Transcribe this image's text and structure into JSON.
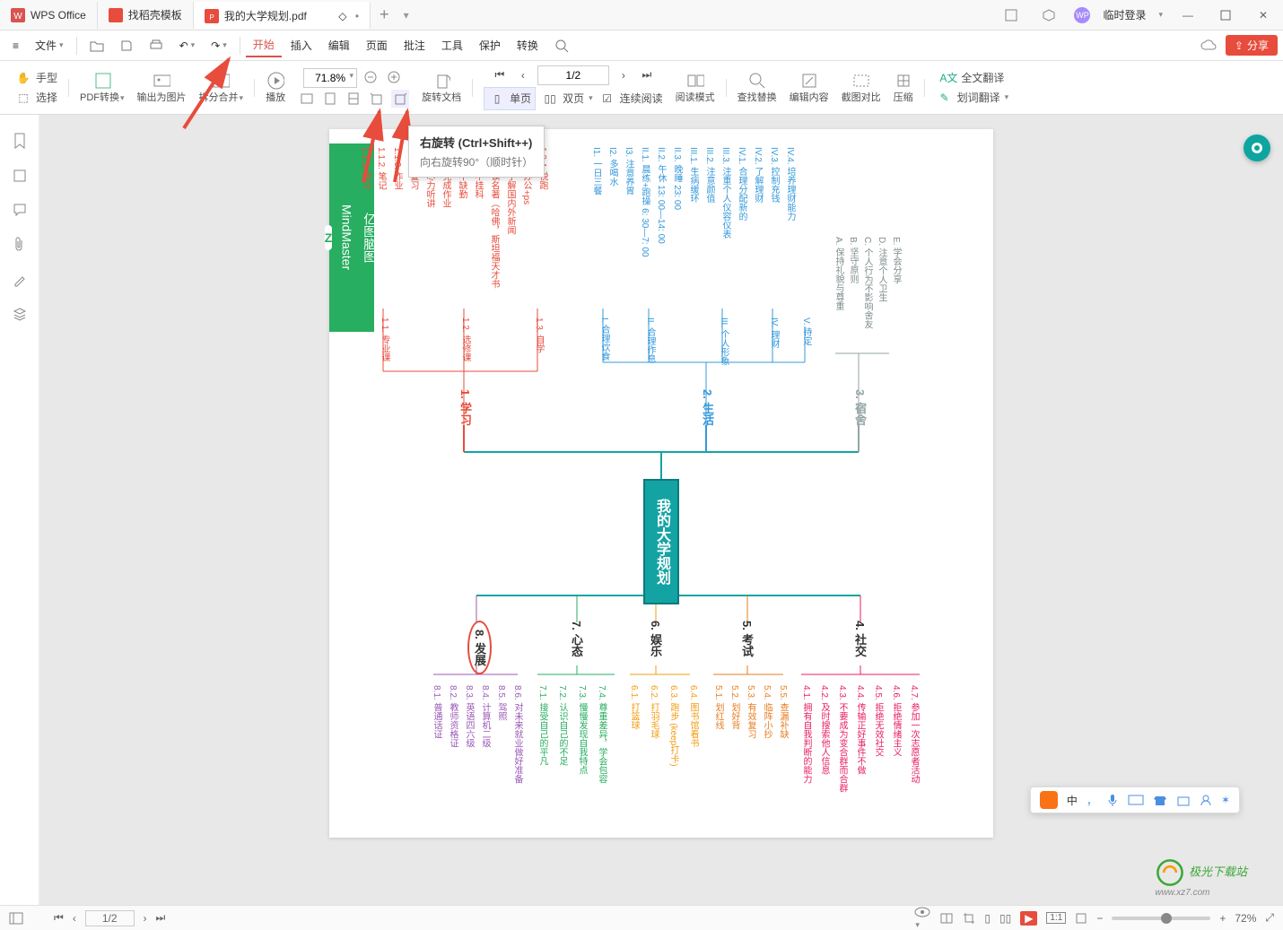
{
  "titlebar": {
    "app_name": "WPS Office",
    "tabs": [
      {
        "label": "找稻壳模板"
      },
      {
        "label": "我的大学规划.pdf"
      }
    ],
    "login_label": "临时登录",
    "avatar_text": "WP"
  },
  "menubar": {
    "file_label": "文件",
    "items": [
      "开始",
      "插入",
      "编辑",
      "页面",
      "批注",
      "工具",
      "保护",
      "转换"
    ],
    "active_index": 0,
    "share_label": "分享"
  },
  "ribbon": {
    "hand_label": "手型",
    "select_label": "选择",
    "pdf_convert_label": "PDF转换",
    "output_label": "输出为图片",
    "split_merge_label": "拆分合并",
    "play_label": "播放",
    "zoom_value": "71.8%",
    "rotate_doc_label": "旋转文档",
    "single_page_label": "单页",
    "double_page_label": "双页",
    "continuous_label": "连续阅读",
    "reading_mode_label": "阅读模式",
    "find_replace_label": "查找替换",
    "edit_content_label": "编辑内容",
    "screenshot_compare_label": "截图对比",
    "compress_label": "压缩",
    "full_translate_label": "全文翻译",
    "select_translate_label": "划词翻译",
    "page_indicator": "1/2"
  },
  "tooltip": {
    "title": "右旋转 (Ctrl+Shift++)",
    "desc": "向右旋转90°（顺时针）"
  },
  "statusbar": {
    "page": "1/2",
    "zoom": "72%"
  },
  "mindmap": {
    "logo_line1": "亿图脑图",
    "logo_line2": "MindMaster",
    "root": "我的大学规划",
    "branches_top": [
      {
        "label": "1. 学习",
        "color": "#e74c3c"
      },
      {
        "label": "2. 生活",
        "color": "#3498db"
      },
      {
        "label": "3. 宿舍",
        "color": "#95a5a6"
      }
    ],
    "branches_bottom": [
      {
        "label": "8. 发展",
        "color": "#e74c3c",
        "circled": true
      },
      {
        "label": "7. 心态",
        "color": "#27ae60"
      },
      {
        "label": "6. 娱乐",
        "color": "#f39c12"
      },
      {
        "label": "5. 考试",
        "color": "#e67e22"
      },
      {
        "label": "4. 社交",
        "color": "#e91e63"
      }
    ],
    "sub_study": [
      "1.1. 专业课",
      "1.2. 选修课",
      "1.3. 自学"
    ],
    "leaves_study": [
      "1.1.1. 预习",
      "1.1.2. 笔记",
      "1.1.3. 作业",
      "1.1.4. 复习",
      "1.2.1. 尽力听讲",
      "1.2.2. 完成作业",
      "1.2.3. 不缺勤",
      "1.2.4. 不挂科",
      "1.3.1. 读名著（哈佛，斯坦福天才书",
      "1.3.2. 了解国内外新闻",
      "1.3.3. 办公+ps",
      "1.3.4. 悦跑"
    ],
    "sub_life": [
      "I. 合理饮食",
      "II. 合理作息",
      "III. 个人形象",
      "IV. 理财",
      "V. 待定"
    ],
    "leaves_life": [
      "I1. 一日三餐",
      "I2. 多喝水",
      "I3. 注意养胃",
      "II.1. 晨练+跑操 6: 30—7: 00",
      "II.2. 午休 13: 00—14: 00",
      "II.3. 晚睡 23: 00",
      "III.1. 生病缓环",
      "III.2. 注意颜值",
      "III.3. 注重个人仪容仪表",
      "IV.1. 合理分配新的",
      "IV.2. 了解理财",
      "IV.3. 控制充钱",
      "IV.4. 培养理财能力"
    ],
    "leaves_dorm": [
      "A. 保持礼貌与尊重",
      "B. 坚守原则",
      "C. 个人行为不影响舍友",
      "D. 注意个人卫生",
      "E. 学会分享"
    ],
    "leaves_develop": [
      "8.1. 普通话证",
      "8.2. 教师资格证",
      "8.3. 英语四六级",
      "8.4. 计算机二级",
      "8.5. 驾照",
      "8.6. 对未来就业做好准备"
    ],
    "leaves_mind": [
      "7.1. 接受自己的平凡",
      "7.2. 认识自己的不足",
      "7.3. 慢慢发现自我特点",
      "7.4. 尊重差异，学会包容"
    ],
    "leaves_fun": [
      "6.1. 打篮球",
      "6.2. 打羽毛球",
      "6.3. 跑步 (keep打卡)",
      "6.4. 图书馆看书"
    ],
    "leaves_exam": [
      "5.1. 划红线",
      "5.2. 划好背",
      "5.3. 有效复习",
      "5.4. 临阵小抄",
      "5.5. 查漏补缺"
    ],
    "leaves_social": [
      "4.1. 拥有自我判断的能力",
      "4.2. 及时搜索他人信息",
      "4.3. 不要成为变合群而合群",
      "4.4. 传输正好事件不做",
      "4.5. 拒绝无效社交",
      "4.6. 拒绝情绪主义",
      "4.7. 参加一次志愿者活动"
    ]
  },
  "ime": {
    "label": "中"
  },
  "watermark": {
    "line1": "极光下载站",
    "line2": "www.xz7.com"
  }
}
